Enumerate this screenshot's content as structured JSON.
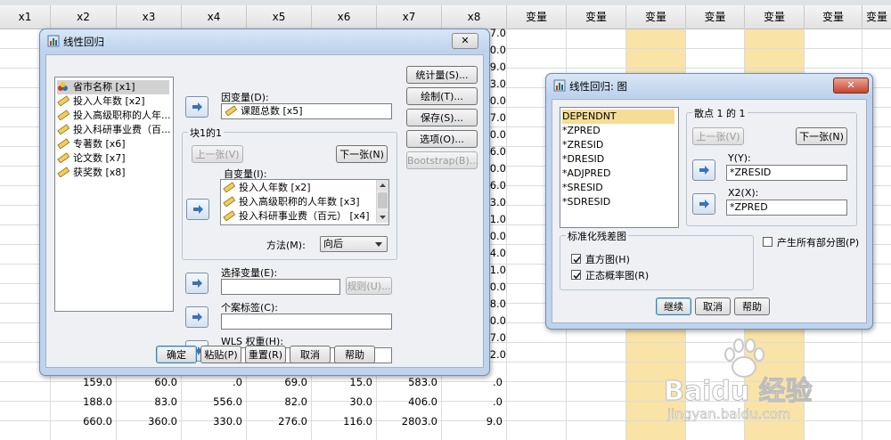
{
  "sheet": {
    "headers": [
      "x1",
      "x2",
      "x3",
      "x4",
      "x5",
      "x6",
      "x7",
      "x8",
      "变量",
      "变量",
      "变量",
      "变量",
      "变量",
      "变量",
      "变量"
    ],
    "edge_values": [
      "7.0",
      "0.0",
      "9.0",
      "3.0",
      "0.0",
      "7.0",
      "0.0",
      "6.0",
      "0.0",
      "6.0",
      "3.0",
      "1.0",
      "0.0",
      "4.0",
      "1.0",
      "0.0",
      "8.0",
      "0.0",
      "7.0",
      "2.0"
    ],
    "rows": [
      [
        "159.0",
        "60.0",
        ".0",
        "69.0",
        "15.0",
        "583.0",
        ".0"
      ],
      [
        "188.0",
        "83.0",
        "556.0",
        "82.0",
        "30.0",
        "406.0",
        ".0"
      ],
      [
        "660.0",
        "360.0",
        "330.0",
        "276.0",
        "116.0",
        "2803.0",
        "9.0"
      ]
    ]
  },
  "main_dialog": {
    "title": "线性回归",
    "variables": [
      "省市名称 [x1]",
      "投入人年数 [x2]",
      "投入高级职称的人年...",
      "投入科研事业费（百...",
      "专著数 [x6]",
      "论文数 [x7]",
      "获奖数 [x8]"
    ],
    "dependent_label": "因变量(D):",
    "dependent_value": "课题总数 [x5]",
    "block_label": "块1的1",
    "prev_label": "上一张(V)",
    "next_label": "下一张(N)",
    "independent_label": "自变量(I):",
    "independents": [
      "投入人年数 [x2]",
      "投入高级职称的人年数 [x3]",
      "投入科研事业费（百元） [x4]"
    ],
    "method_label": "方法(M):",
    "method_value": "向后",
    "select_var_label": "选择变量(E):",
    "rule_label": "规则(U)...",
    "case_label_label": "个案标签(C):",
    "wls_label": "WLS 权重(H):",
    "side_buttons": [
      "统计量(S)...",
      "绘制(T)...",
      "保存(S)...",
      "选项(O)...",
      "Bootstrap(B)..."
    ],
    "bottom_buttons": [
      "确定",
      "粘贴(P)",
      "重置(R)",
      "取消",
      "帮助"
    ]
  },
  "plot_dialog": {
    "title": "线性回归: 图",
    "variables": [
      "DEPENDNT",
      "*ZPRED",
      "*ZRESID",
      "*DRESID",
      "*ADJPRED",
      "*SRESID",
      "*SDRESID"
    ],
    "scatter_label": "散点 1 的 1",
    "prev_label": "上一张(V)",
    "next_label": "下一张(N)",
    "y_label": "Y(Y):",
    "y_value": "*ZRESID",
    "x_label": "X2(X):",
    "x_value": "*ZPRED",
    "std_group_label": "标准化残差图",
    "histogram_label": "直方图(H)",
    "normal_prob_label": "正态概率图(R)",
    "partial_label": "产生所有部分图(P)",
    "bottom_buttons": [
      "继续",
      "取消",
      "帮助"
    ]
  },
  "watermark": {
    "brand": "Baidu 经验",
    "url": "jingyan.baidu.com"
  },
  "colors": {
    "highlight_column": "#f9e3a7",
    "dialog_frame": "#bfd4ec",
    "dialog_body": "#eef0f3"
  }
}
